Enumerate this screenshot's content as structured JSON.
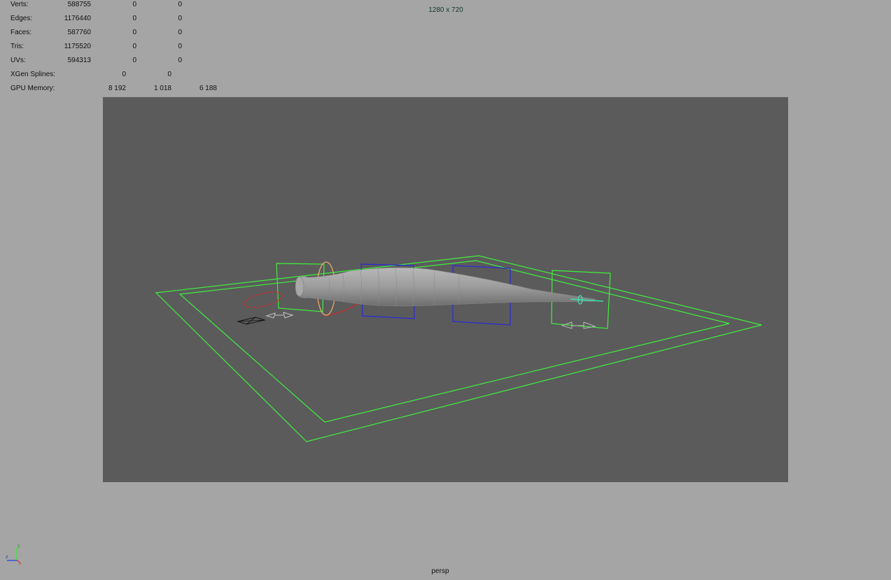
{
  "hud": {
    "verts": {
      "label": "Verts:",
      "values": [
        "588755",
        "0",
        "0"
      ]
    },
    "edges": {
      "label": "Edges:",
      "values": [
        "1176440",
        "0",
        "0"
      ]
    },
    "faces": {
      "label": "Faces:",
      "values": [
        "587760",
        "0",
        "0"
      ]
    },
    "tris": {
      "label": "Tris:",
      "values": [
        "1175520",
        "0",
        "0"
      ]
    },
    "uvs": {
      "label": "UVs:",
      "values": [
        "594313",
        "0",
        "0"
      ]
    },
    "xgen": {
      "label": "XGen Splines:",
      "values": [
        "0",
        "0"
      ]
    },
    "gpu": {
      "label": "GPU Memory:",
      "values": [
        "8 192",
        "1 018",
        "6 188"
      ]
    }
  },
  "viewport": {
    "resolution": "1280 x 720",
    "camera": "persp",
    "background_color": "#a5a5a5",
    "gate_color": "#5b5b5b",
    "wire_green": "#3ef03e",
    "wire_blue": "#2a2ad8",
    "wire_red": "#d02828",
    "wire_orange": "#e8a868",
    "wire_cyan": "#40e0b0"
  },
  "axis_indicator": {
    "y_label": "y",
    "z_label": "z",
    "x_label": "x"
  }
}
